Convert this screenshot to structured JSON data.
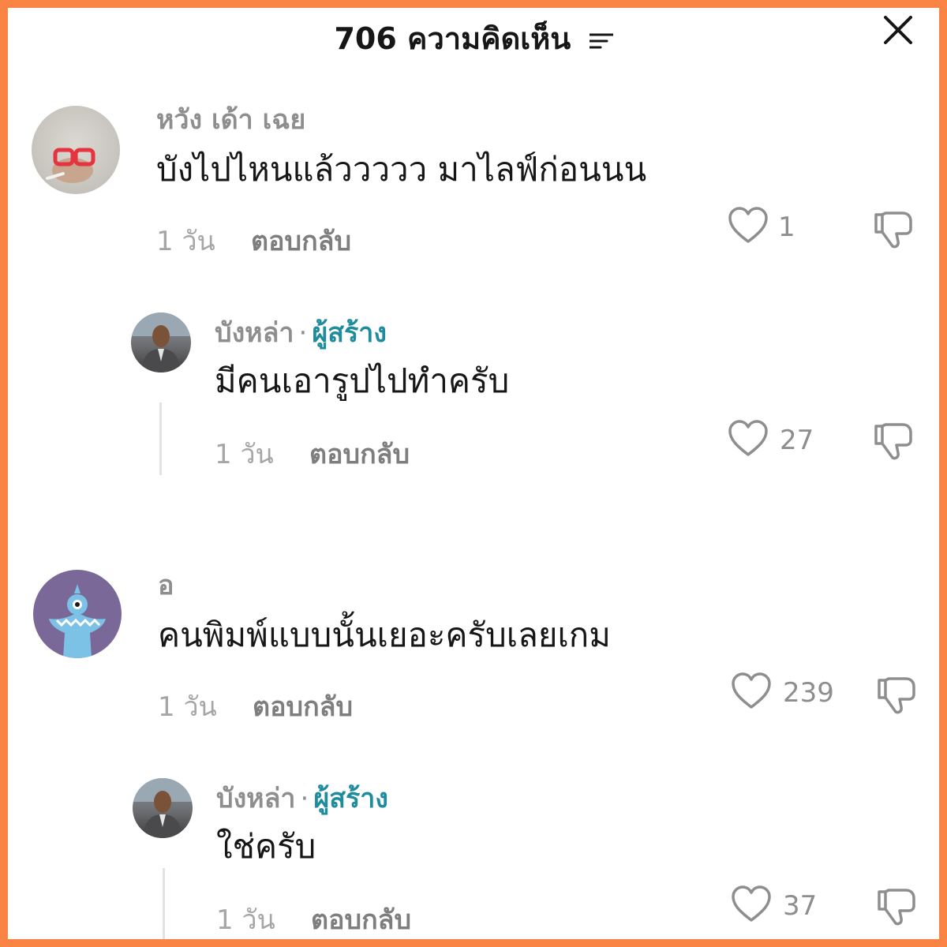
{
  "header": {
    "title": "706 ความคิดเห็น",
    "sort_icon": "sort-lines-icon",
    "close_icon": "close-x-icon"
  },
  "comments": [
    {
      "username": "หวัง เด้า เฉย",
      "text": "บังไปไหนแล้ววววว มาไลฟ์ก่อนนน",
      "time": "1 วัน",
      "reply_label": "ตอบกลับ",
      "likes": "1"
    },
    {
      "username": "บังหล่า",
      "dot": "·",
      "creator_badge": "ผู้สร้าง",
      "text": "มีคนเอารูปไปทำครับ",
      "time": "1 วัน",
      "reply_label": "ตอบกลับ",
      "likes": "27"
    },
    {
      "username": "อ",
      "text": "คนพิมพ์แบบนั้นเยอะครับเลยเกม",
      "time": "1 วัน",
      "reply_label": "ตอบกลับ",
      "likes": "239"
    },
    {
      "username": "บังหล่า",
      "dot": "·",
      "creator_badge": "ผู้สร้าง",
      "text": "ใช่ครับ",
      "time": "1 วัน",
      "reply_label": "ตอบกลับ",
      "likes": "37"
    }
  ],
  "colors": {
    "frame_border": "#fa8443",
    "creator_badge": "#1f8c9e",
    "username": "#8e8e8e",
    "text": "#161616"
  }
}
